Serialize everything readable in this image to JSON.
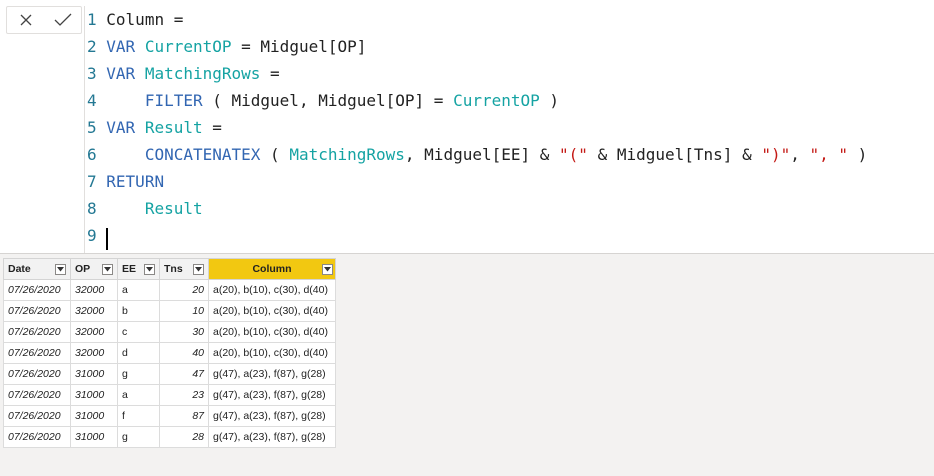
{
  "formula_bar": {
    "cancel_icon": "close-icon",
    "commit_icon": "check-icon",
    "lines": [
      {
        "n": "1",
        "tokens": [
          {
            "t": "Column =",
            "c": "plain"
          }
        ]
      },
      {
        "n": "2",
        "tokens": [
          {
            "t": "VAR ",
            "c": "kw"
          },
          {
            "t": "CurrentOP",
            "c": "var"
          },
          {
            "t": " = Midguel[OP]",
            "c": "plain"
          }
        ]
      },
      {
        "n": "3",
        "tokens": [
          {
            "t": "VAR ",
            "c": "kw"
          },
          {
            "t": "MatchingRows",
            "c": "var"
          },
          {
            "t": " =",
            "c": "plain"
          }
        ]
      },
      {
        "n": "4",
        "tokens": [
          {
            "t": "    ",
            "c": "plain"
          },
          {
            "t": "FILTER",
            "c": "fn"
          },
          {
            "t": " ( Midguel, Midguel[OP] = ",
            "c": "plain"
          },
          {
            "t": "CurrentOP",
            "c": "var"
          },
          {
            "t": " )",
            "c": "plain"
          }
        ]
      },
      {
        "n": "5",
        "tokens": [
          {
            "t": "VAR ",
            "c": "kw"
          },
          {
            "t": "Result",
            "c": "var"
          },
          {
            "t": " =",
            "c": "plain"
          }
        ]
      },
      {
        "n": "6",
        "tokens": [
          {
            "t": "    ",
            "c": "plain"
          },
          {
            "t": "CONCATENATEX",
            "c": "fn"
          },
          {
            "t": " ( ",
            "c": "plain"
          },
          {
            "t": "MatchingRows",
            "c": "var"
          },
          {
            "t": ", Midguel[EE] & ",
            "c": "plain"
          },
          {
            "t": "\"(\"",
            "c": "str"
          },
          {
            "t": " & Midguel[Tns] & ",
            "c": "plain"
          },
          {
            "t": "\")\"",
            "c": "str"
          },
          {
            "t": ", ",
            "c": "plain"
          },
          {
            "t": "\", \"",
            "c": "str"
          },
          {
            "t": " )",
            "c": "plain"
          }
        ]
      },
      {
        "n": "7",
        "tokens": [
          {
            "t": "RETURN",
            "c": "kw"
          }
        ]
      },
      {
        "n": "8",
        "tokens": [
          {
            "t": "    ",
            "c": "plain"
          },
          {
            "t": "Result",
            "c": "var"
          }
        ]
      },
      {
        "n": "9",
        "tokens": []
      }
    ]
  },
  "table": {
    "headers": [
      "Date",
      "OP",
      "EE",
      "Tns",
      "Column"
    ],
    "active_column": "Column",
    "rows": [
      [
        "07/26/2020",
        "32000",
        "a",
        "20",
        "a(20), b(10), c(30), d(40)"
      ],
      [
        "07/26/2020",
        "32000",
        "b",
        "10",
        "a(20), b(10), c(30), d(40)"
      ],
      [
        "07/26/2020",
        "32000",
        "c",
        "30",
        "a(20), b(10), c(30), d(40)"
      ],
      [
        "07/26/2020",
        "32000",
        "d",
        "40",
        "a(20), b(10), c(30), d(40)"
      ],
      [
        "07/26/2020",
        "31000",
        "g",
        "47",
        "g(47), a(23), f(87), g(28)"
      ],
      [
        "07/26/2020",
        "31000",
        "a",
        "23",
        "g(47), a(23), f(87), g(28)"
      ],
      [
        "07/26/2020",
        "31000",
        "f",
        "87",
        "g(47), a(23), f(87), g(28)"
      ],
      [
        "07/26/2020",
        "31000",
        "g",
        "28",
        "g(47), a(23), f(87), g(28)"
      ]
    ]
  },
  "colors": {
    "keyword": "#3266b2",
    "variable": "#15a3a3",
    "string": "#c41a16",
    "line_number": "#237893",
    "active_header": "#f2c811"
  }
}
